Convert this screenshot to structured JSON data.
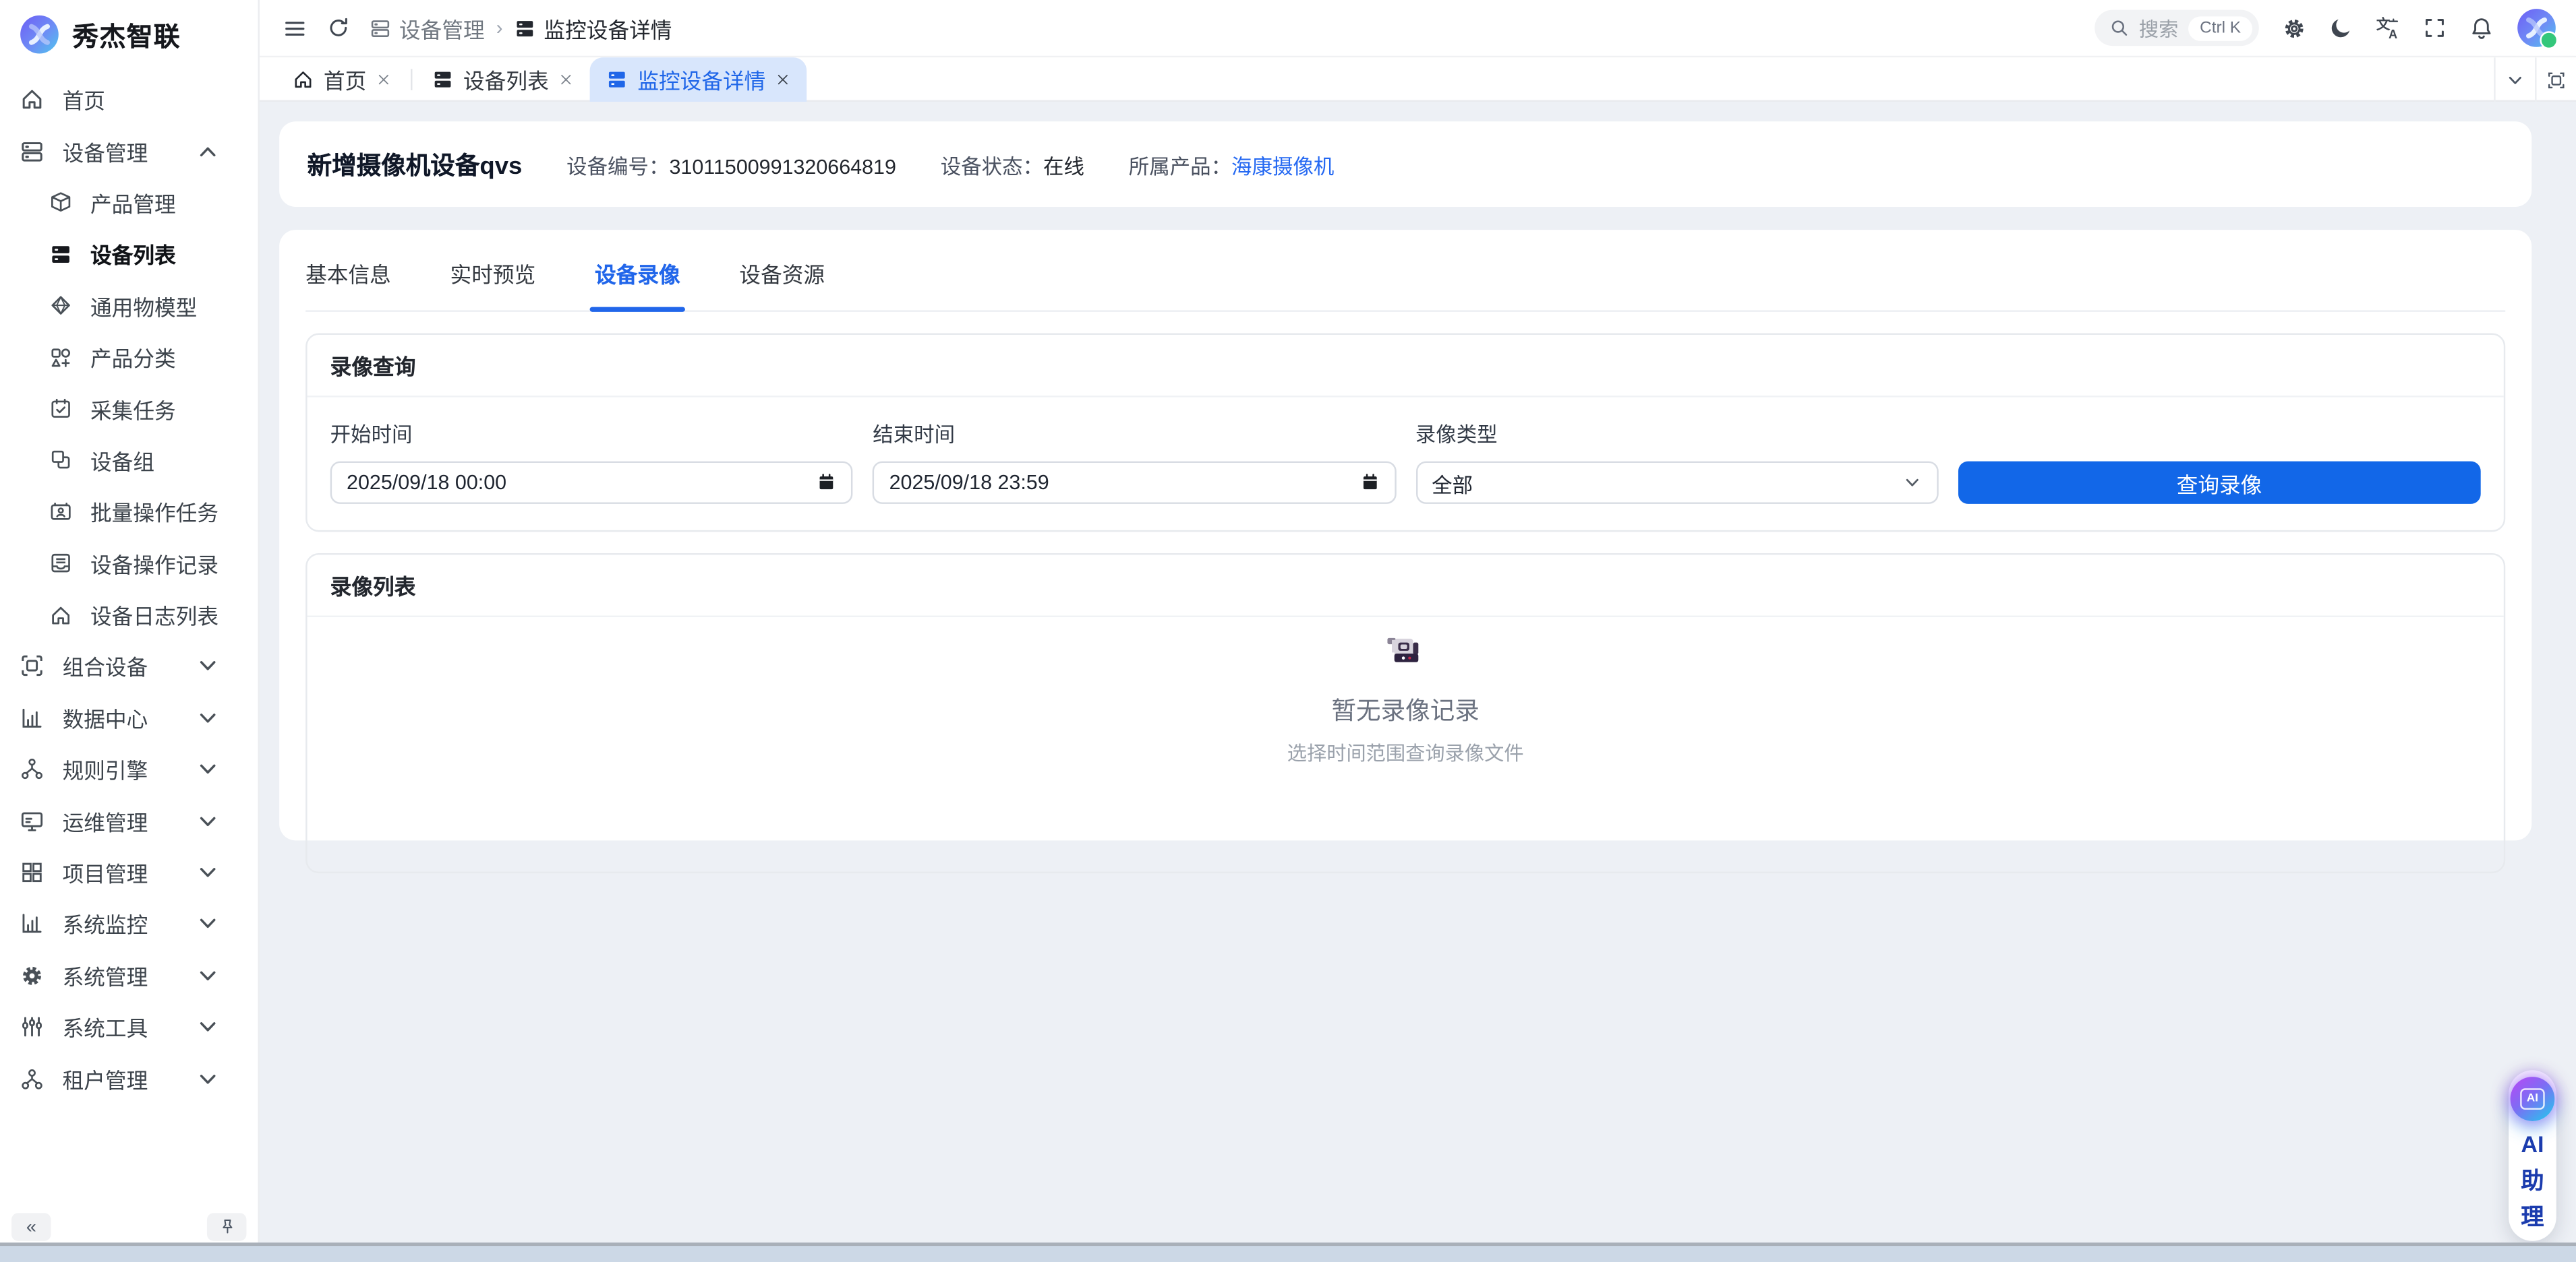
{
  "colors": {
    "accent": "#2166ea",
    "button": "#1267e8",
    "active_tab_bg": "#d8e6fc",
    "link": "#2468f2",
    "main_bg": "#edf0f5",
    "online_dot": "#34c77b"
  },
  "brand": {
    "name": "秀杰智联"
  },
  "sidebar": {
    "items": [
      {
        "label": "首页",
        "icon": "home",
        "level": 0,
        "chevron": "none",
        "active": false
      },
      {
        "label": "设备管理",
        "icon": "server",
        "level": 0,
        "chevron": "up",
        "active": false
      },
      {
        "label": "产品管理",
        "icon": "box",
        "level": 1,
        "chevron": "none",
        "active": false
      },
      {
        "label": "设备列表",
        "icon": "server-filled",
        "level": 1,
        "chevron": "none",
        "active": true
      },
      {
        "label": "通用物模型",
        "icon": "diamond",
        "level": 1,
        "chevron": "none",
        "active": false
      },
      {
        "label": "产品分类",
        "icon": "category",
        "level": 1,
        "chevron": "none",
        "active": false
      },
      {
        "label": "采集任务",
        "icon": "calendar-check",
        "level": 1,
        "chevron": "none",
        "active": false
      },
      {
        "label": "设备组",
        "icon": "group",
        "level": 1,
        "chevron": "none",
        "active": false
      },
      {
        "label": "批量操作任务",
        "icon": "id-card",
        "level": 1,
        "chevron": "none",
        "active": false
      },
      {
        "label": "设备操作记录",
        "icon": "doc-inbox",
        "level": 1,
        "chevron": "none",
        "active": false
      },
      {
        "label": "设备日志列表",
        "icon": "home",
        "level": 1,
        "chevron": "none",
        "active": false
      },
      {
        "label": "组合设备",
        "icon": "combo",
        "level": 0,
        "chevron": "down",
        "active": false
      },
      {
        "label": "数据中心",
        "icon": "chart",
        "level": 0,
        "chevron": "down",
        "active": false
      },
      {
        "label": "规则引擎",
        "icon": "share",
        "level": 0,
        "chevron": "down",
        "active": false
      },
      {
        "label": "运维管理",
        "icon": "monitor",
        "level": 0,
        "chevron": "down",
        "active": false
      },
      {
        "label": "项目管理",
        "icon": "grid",
        "level": 0,
        "chevron": "down",
        "active": false
      },
      {
        "label": "系统监控",
        "icon": "chart",
        "level": 0,
        "chevron": "down",
        "active": false
      },
      {
        "label": "系统管理",
        "icon": "gear",
        "level": 0,
        "chevron": "down",
        "active": false
      },
      {
        "label": "系统工具",
        "icon": "sliders",
        "level": 0,
        "chevron": "down",
        "active": false
      },
      {
        "label": "租户管理",
        "icon": "org",
        "level": 0,
        "chevron": "down",
        "active": false
      }
    ],
    "collapse_label": "«"
  },
  "topbar": {
    "breadcrumbs": [
      {
        "label": "设备管理",
        "icon": "server"
      },
      {
        "label": "监控设备详情",
        "icon": "server-filled"
      }
    ],
    "search": {
      "placeholder": "搜索",
      "shortcut": "Ctrl K"
    }
  },
  "page_tabs": [
    {
      "label": "首页",
      "icon": "home",
      "active": false
    },
    {
      "label": "设备列表",
      "icon": "server-filled",
      "active": false
    },
    {
      "label": "监控设备详情",
      "icon": "server-filled",
      "active": true
    }
  ],
  "device": {
    "title": "新增摄像机设备qvs",
    "fields": [
      {
        "label": "设备编号：",
        "value": "31011500991320664819",
        "link": false
      },
      {
        "label": "设备状态：",
        "value": "在线",
        "link": false
      },
      {
        "label": "所属产品：",
        "value": "海康摄像机",
        "link": true
      }
    ]
  },
  "content_tabs": [
    {
      "label": "基本信息",
      "active": false
    },
    {
      "label": "实时预览",
      "active": false
    },
    {
      "label": "设备录像",
      "active": true
    },
    {
      "label": "设备资源",
      "active": false
    }
  ],
  "query": {
    "title": "录像查询",
    "fields": [
      {
        "label": "开始时间",
        "value": "2025/09/18 00:00",
        "control": "datetime"
      },
      {
        "label": "结束时间",
        "value": "2025/09/18 23:59",
        "control": "datetime"
      },
      {
        "label": "录像类型",
        "value": "全部",
        "control": "select"
      }
    ],
    "button": "查询录像"
  },
  "list": {
    "title": "录像列表",
    "empty_title": "暂无录像记录",
    "empty_hint": "选择时间范围查询录像文件"
  },
  "ai": {
    "badge": "AI",
    "lines": [
      "AI",
      "助",
      "理"
    ]
  }
}
